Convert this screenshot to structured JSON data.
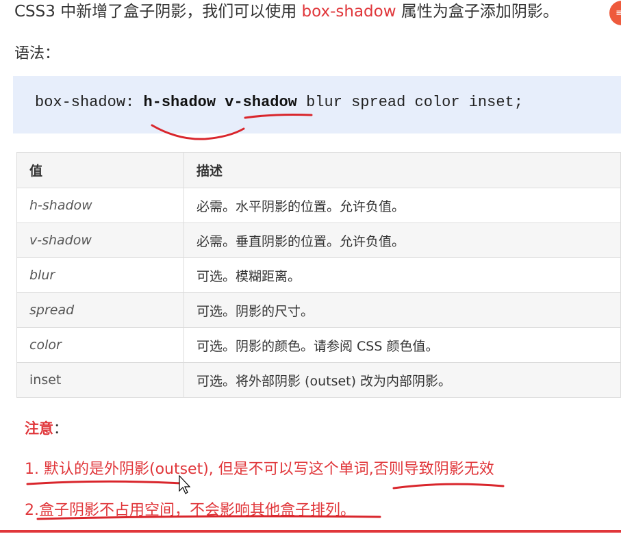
{
  "intro": {
    "before": "CSS3 中新增了盒子阴影，我们可以使用 ",
    "property": "box-shadow",
    "after": " 属性为盒子添加阴影。"
  },
  "syntax_label": "语法：",
  "code": {
    "prefix": "box-shadow: ",
    "bold1": "h-shadow",
    "bold2": "v-shadow",
    "rest": " blur spread color inset;"
  },
  "table": {
    "headers": [
      "值",
      "描述"
    ],
    "rows": [
      {
        "value": "h-shadow",
        "desc": "必需。水平阴影的位置。允许负值。"
      },
      {
        "value": "v-shadow",
        "desc": "必需。垂直阴影的位置。允许负值。"
      },
      {
        "value": "blur",
        "desc": "可选。模糊距离。"
      },
      {
        "value": "spread",
        "desc": "可选。阴影的尺寸。"
      },
      {
        "value": "color",
        "desc": "可选。阴影的颜色。请参阅 CSS 颜色值。"
      },
      {
        "value": "inset",
        "desc": "可选。将外部阴影 (outset) 改为内部阴影。"
      }
    ]
  },
  "note": {
    "title": "注意",
    "colon": "：",
    "line1": "1. 默认的是外阴影(outset), 但是不可以写这个单词,否则导致阴影无效",
    "line2": "2.盒子阴影不占用空间，不会影响其他盒子排列。"
  },
  "colors": {
    "accent": "#e0363a",
    "code_bg": "#e7eefb",
    "annotation_ink": "#d9262c"
  }
}
